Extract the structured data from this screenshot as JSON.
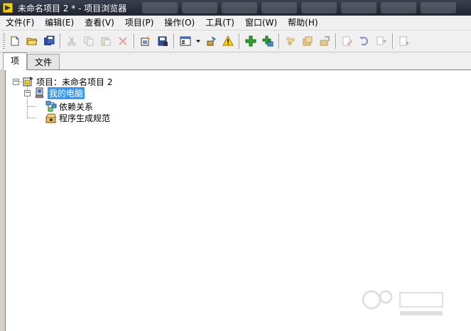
{
  "window": {
    "title": "未命名项目 2 * - 项目浏览器",
    "app_icon": "labview-project-icon"
  },
  "menu": [
    {
      "id": "file",
      "label": "文件(F)"
    },
    {
      "id": "edit",
      "label": "编辑(E)"
    },
    {
      "id": "view",
      "label": "查看(V)"
    },
    {
      "id": "project",
      "label": "项目(P)"
    },
    {
      "id": "operate",
      "label": "操作(O)"
    },
    {
      "id": "tools",
      "label": "工具(T)"
    },
    {
      "id": "window",
      "label": "窗口(W)"
    },
    {
      "id": "help",
      "label": "帮助(H)"
    }
  ],
  "toolbar": {
    "buttons": [
      "new-icon",
      "open-icon",
      "save-all-icon",
      "cut-icon",
      "copy-icon",
      "paste-icon",
      "delete-icon",
      "project-properties-icon",
      "save-project-icon",
      "view-options-icon",
      "dropdown-arrow-icon",
      "build-tools-icon",
      "warning-icon",
      "add-item-icon",
      "add-folder-icon",
      "build-icon",
      "build-all-icon",
      "deploy-icon",
      "check-icon",
      "undo-icon",
      "redo-icon",
      "properties-icon"
    ]
  },
  "tabs": [
    {
      "label": "项",
      "active": true
    },
    {
      "label": "文件",
      "active": false
    }
  ],
  "tree": {
    "root": {
      "label": "项目：未命名项目 2",
      "icon": "project-icon",
      "expander": "−"
    },
    "computer": {
      "label": "我的电脑",
      "icon": "computer-icon",
      "expander": "−",
      "selected": true
    },
    "children": [
      {
        "label": "依赖关系",
        "icon": "dependencies-icon"
      },
      {
        "label": "程序生成规范",
        "icon": "build-specifications-icon"
      }
    ]
  },
  "colors": {
    "selection": "#3399ff",
    "titlebar": "#2b303d",
    "chrome": "#f0f0f0"
  }
}
